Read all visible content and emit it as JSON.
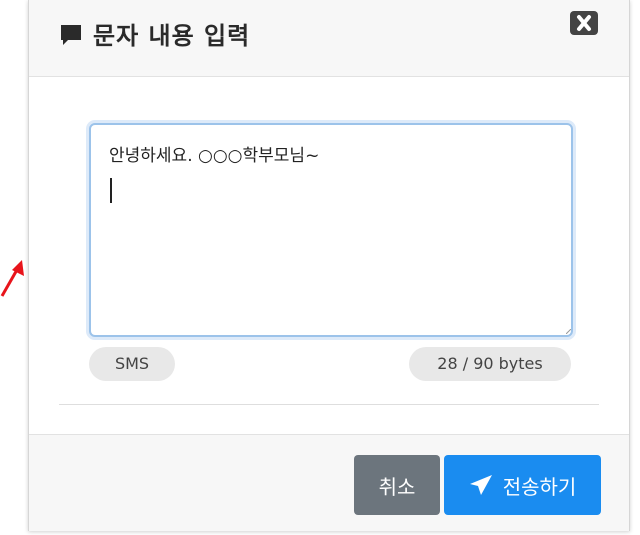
{
  "modal": {
    "title": "문자 내용 입력",
    "title_icon": "speech-bubble-icon",
    "close_icon": "close-icon"
  },
  "message": {
    "value": "안녕하세요. ○○○학부모님~\n"
  },
  "meta": {
    "type_label": "SMS",
    "byte_count": "28 / 90 bytes"
  },
  "footer": {
    "cancel_label": "취소",
    "send_label": "전송하기",
    "send_icon": "paper-plane-icon"
  },
  "colors": {
    "send_button": "#1a8cf0",
    "cancel_button": "#6c757d",
    "focus_border": "#9cc3ea",
    "annotation_arrow": "#e8141b"
  }
}
